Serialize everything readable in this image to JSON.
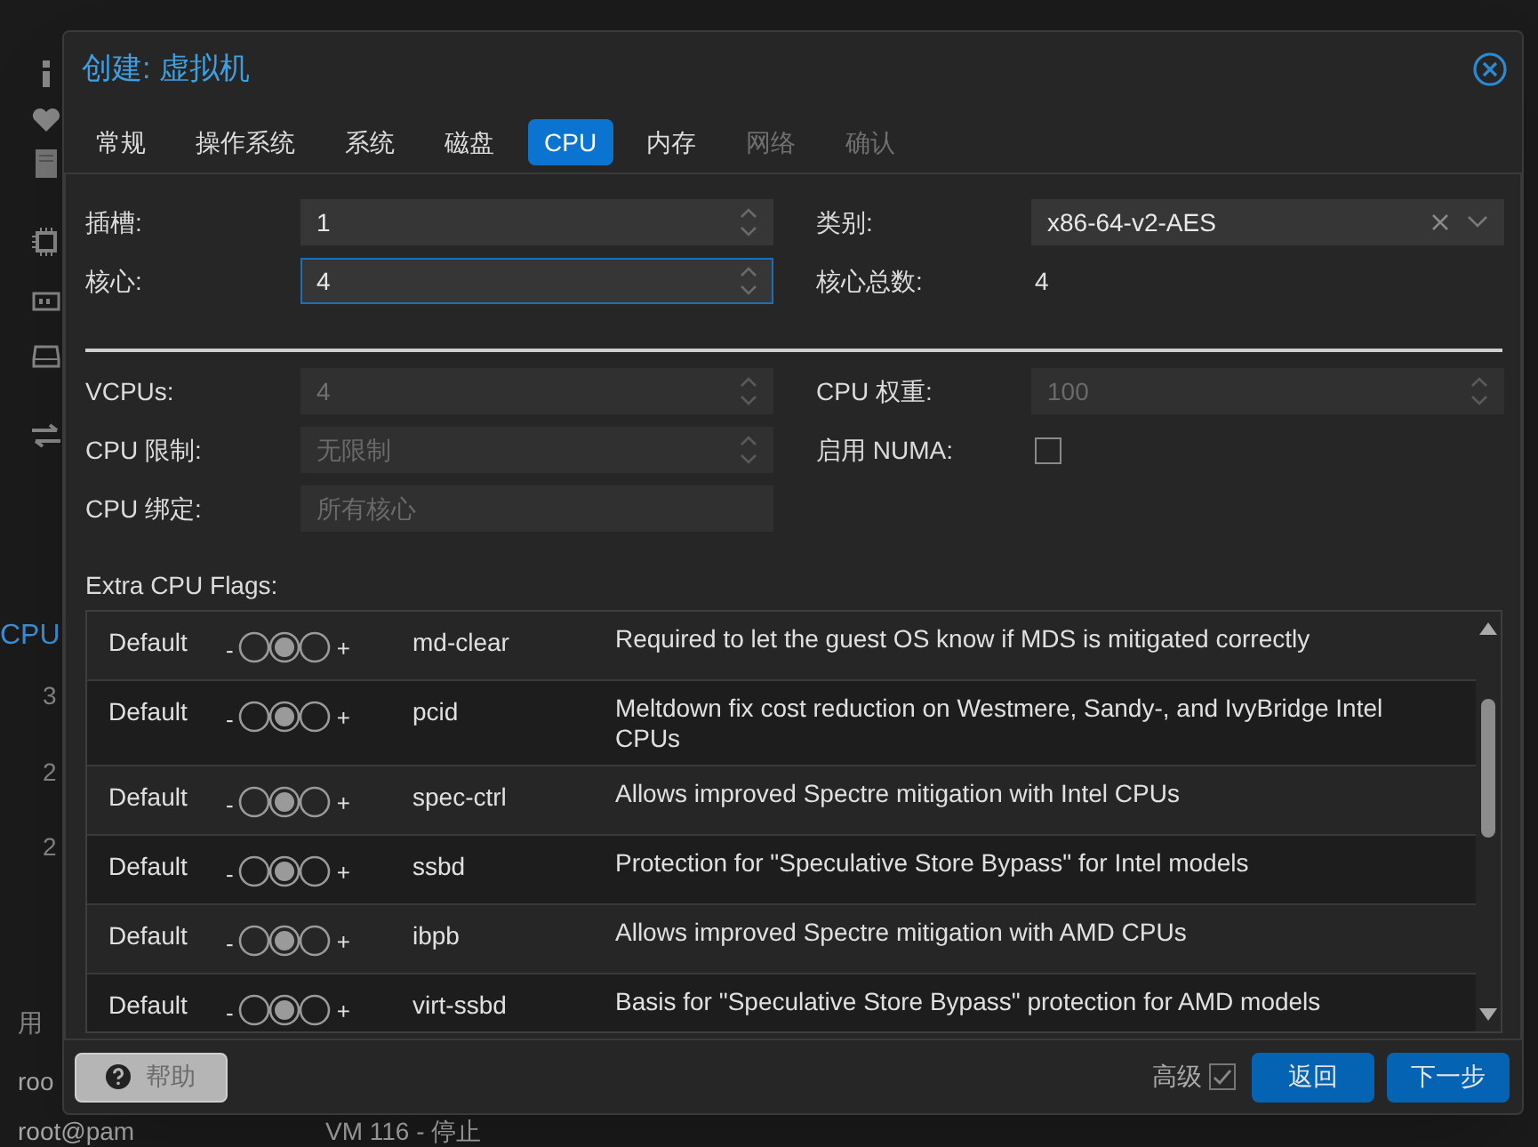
{
  "background": {
    "sidebar_texts": [
      "CPU",
      "3",
      "2",
      "2",
      "用",
      "roo"
    ],
    "bottom_row": {
      "user": "root@pam",
      "vm": "VM 116 - 停止"
    }
  },
  "dialog": {
    "title": "创建: 虚拟机",
    "tabs": [
      {
        "label": "常规",
        "selected": false,
        "disabled": false
      },
      {
        "label": "操作系统",
        "selected": false,
        "disabled": false
      },
      {
        "label": "系统",
        "selected": false,
        "disabled": false
      },
      {
        "label": "磁盘",
        "selected": false,
        "disabled": false
      },
      {
        "label": "CPU",
        "selected": true,
        "disabled": false
      },
      {
        "label": "内存",
        "selected": false,
        "disabled": false
      },
      {
        "label": "网络",
        "selected": false,
        "disabled": true
      },
      {
        "label": "确认",
        "selected": false,
        "disabled": true
      }
    ],
    "upper_left": [
      {
        "label": "插槽:",
        "kind": "spinner",
        "value": "1",
        "focused": false,
        "disabled": false
      },
      {
        "label": "核心:",
        "kind": "spinner",
        "value": "4",
        "focused": true,
        "disabled": false
      }
    ],
    "upper_right": [
      {
        "label": "类别:",
        "kind": "combo",
        "value": "x86-64-v2-AES",
        "focused": false
      },
      {
        "label": "核心总数:",
        "kind": "display",
        "value": "4"
      }
    ],
    "lower_left": [
      {
        "label": "VCPUs:",
        "kind": "spinner",
        "value": "4",
        "focused": false,
        "disabled": true
      },
      {
        "label": "CPU 限制:",
        "kind": "spinner",
        "placeholder": "无限制",
        "focused": false,
        "disabled": true
      },
      {
        "label": "CPU 绑定:",
        "kind": "text",
        "placeholder": "所有核心",
        "focused": false,
        "disabled": true
      }
    ],
    "lower_right": [
      {
        "label": "CPU 权重:",
        "kind": "spinner",
        "placeholder": "100",
        "focused": false,
        "disabled": true
      },
      {
        "label": "启用 NUMA:",
        "kind": "checkbox",
        "checked": false
      }
    ],
    "flags_label": "Extra CPU Flags:",
    "flags": [
      {
        "state_label": "Default",
        "options": [
          {
            "selected": false
          },
          {
            "selected": true
          },
          {
            "selected": false
          }
        ],
        "minus": "-",
        "plus": "+",
        "name": "md-clear",
        "description": "Required to let the guest OS know if MDS is mitigated correctly"
      },
      {
        "state_label": "Default",
        "options": [
          {
            "selected": false
          },
          {
            "selected": true
          },
          {
            "selected": false
          }
        ],
        "minus": "-",
        "plus": "+",
        "name": "pcid",
        "description": "Meltdown fix cost reduction on Westmere, Sandy-, and IvyBridge Intel CPUs"
      },
      {
        "state_label": "Default",
        "options": [
          {
            "selected": false
          },
          {
            "selected": true
          },
          {
            "selected": false
          }
        ],
        "minus": "-",
        "plus": "+",
        "name": "spec-ctrl",
        "description": "Allows improved Spectre mitigation with Intel CPUs"
      },
      {
        "state_label": "Default",
        "options": [
          {
            "selected": false
          },
          {
            "selected": true
          },
          {
            "selected": false
          }
        ],
        "minus": "-",
        "plus": "+",
        "name": "ssbd",
        "description": "Protection for \"Speculative Store Bypass\" for Intel models"
      },
      {
        "state_label": "Default",
        "options": [
          {
            "selected": false
          },
          {
            "selected": true
          },
          {
            "selected": false
          }
        ],
        "minus": "-",
        "plus": "+",
        "name": "ibpb",
        "description": "Allows improved Spectre mitigation with AMD CPUs"
      },
      {
        "state_label": "Default",
        "options": [
          {
            "selected": false
          },
          {
            "selected": true
          },
          {
            "selected": false
          }
        ],
        "minus": "-",
        "plus": "+",
        "name": "virt-ssbd",
        "description": "Basis for \"Speculative Store Bypass\" protection for AMD models"
      }
    ],
    "help_button": "帮助",
    "advanced": {
      "label": "高级",
      "checked": true
    },
    "buttons": [
      "返回",
      "下一步"
    ]
  }
}
